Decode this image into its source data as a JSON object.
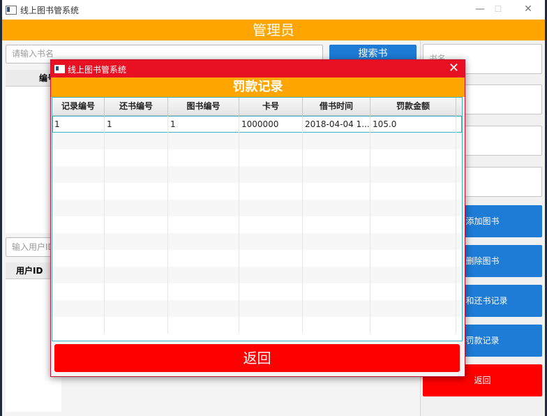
{
  "main_window": {
    "title": "线上图书管系统",
    "controls": [
      "—",
      "☐",
      "✕"
    ],
    "banner": "管理员",
    "search_placeholder": "请输入书名",
    "search_button": "搜索书",
    "book_table_header": "编号",
    "user_input_placeholder": "输入用户ID",
    "user_table_header": "用户ID",
    "right_panel": {
      "field_placeholder": "书名",
      "buttons": [
        "添加图书",
        "删除图书",
        "书和还书记录",
        "罚款记录",
        "返回"
      ]
    }
  },
  "dialog": {
    "title": "线上图书管系统",
    "close": "✕",
    "banner": "罚款记录",
    "columns": [
      "记录编号",
      "还书编号",
      "图书编号",
      "卡号",
      "借书时间",
      "罚款金额"
    ],
    "rows": [
      [
        "1",
        "1",
        "1",
        "1000000",
        "2018-04-04 1...",
        "105.0"
      ]
    ],
    "back_button": "返回"
  },
  "colors": {
    "orange": "#ffa500",
    "blue": "#1e7bd6",
    "red": "#ff0000",
    "title_red": "#e81123"
  }
}
